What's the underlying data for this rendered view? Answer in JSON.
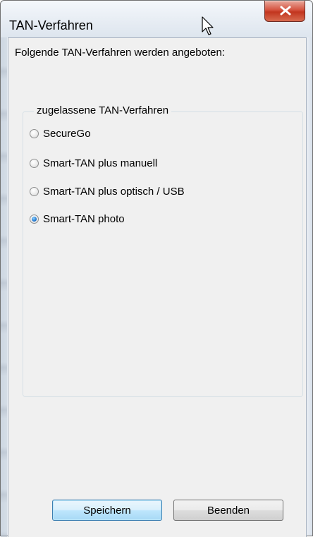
{
  "window": {
    "title": "TAN-Verfahren"
  },
  "main": {
    "intro_text": "Folgende TAN-Verfahren werden angeboten:",
    "group": {
      "legend": "zugelassene TAN-Verfahren",
      "options": [
        {
          "label": "SecureGo",
          "checked": false
        },
        {
          "label": "Smart-TAN plus manuell",
          "checked": false
        },
        {
          "label": "Smart-TAN plus optisch / USB",
          "checked": false
        },
        {
          "label": "Smart-TAN photo",
          "checked": true
        }
      ]
    }
  },
  "buttons": {
    "save_label": "Speichern",
    "exit_label": "Beenden"
  },
  "colors": {
    "close_button": "#c2351f",
    "radio_selected": "#2a7fd4",
    "default_button_border": "#3c7fb1"
  }
}
